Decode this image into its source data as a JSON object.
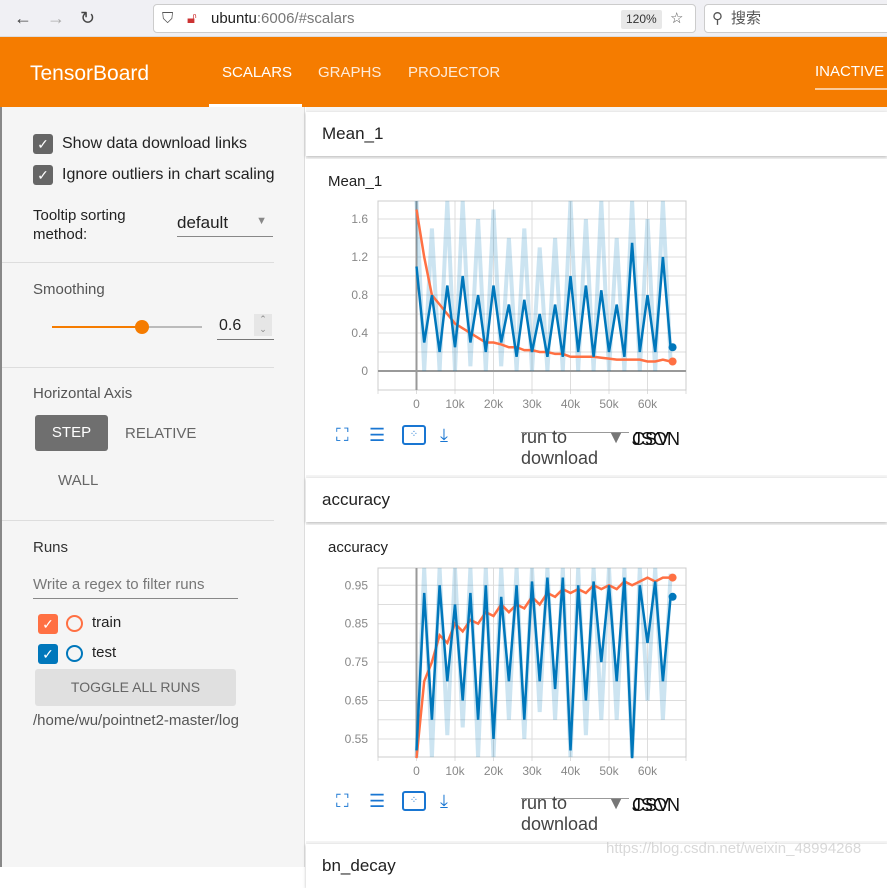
{
  "browser": {
    "back": "←",
    "forward": "→",
    "reload": "↻",
    "url_host": "ubuntu",
    "url_rest": ":6006/#scalars",
    "zoom": "120%",
    "search_placeholder": "搜索"
  },
  "header": {
    "title": "TensorBoard",
    "tabs": [
      {
        "label": "SCALARS",
        "active": true
      },
      {
        "label": "GRAPHS"
      },
      {
        "label": "PROJECTOR"
      }
    ],
    "status": "INACTIVE",
    "color": "#f57c00"
  },
  "sidebar": {
    "show_download_links": {
      "label": "Show data download links",
      "checked": true
    },
    "ignore_outliers": {
      "label": "Ignore outliers in chart scaling",
      "checked": true
    },
    "tooltip_sorting": {
      "label": "Tooltip sorting method:",
      "value": "default"
    },
    "smoothing": {
      "label": "Smoothing",
      "value": "0.6",
      "fraction": 0.6
    },
    "horizontal_axis": {
      "label": "Horizontal Axis",
      "options": [
        "STEP",
        "RELATIVE",
        "WALL"
      ],
      "selected": "STEP"
    },
    "runs": {
      "label": "Runs",
      "filter_placeholder": "Write a regex to filter runs",
      "items": [
        {
          "name": "train",
          "checked": true,
          "color": "#ff7043"
        },
        {
          "name": "test",
          "checked": true,
          "color": "#0077bb"
        }
      ],
      "toggle_all": "TOGGLE ALL RUNS",
      "logdir": "/home/wu/pointnet2-master/log"
    }
  },
  "sections": [
    {
      "title": "Mean_1"
    },
    {
      "title": "accuracy"
    },
    {
      "title": "bn_decay"
    }
  ],
  "card_tools": {
    "run_to_download": "run to download",
    "csv": "CSV",
    "json": "JSON"
  },
  "watermark": "https://blog.csdn.net/weixin_48994268",
  "chart_data": [
    {
      "type": "line",
      "title": "Mean_1",
      "xlim": [
        -10000,
        70000
      ],
      "ylim": [
        -0.2,
        1.79
      ],
      "xticks": [
        "0",
        "10k",
        "20k",
        "30k",
        "40k",
        "50k",
        "60k"
      ],
      "yticks": [
        "0",
        "0.4",
        "0.8",
        "1.2",
        "1.6"
      ],
      "grid": true,
      "x": [
        0,
        2000,
        4000,
        6000,
        8000,
        10000,
        12000,
        14000,
        16000,
        18000,
        20000,
        22000,
        24000,
        26000,
        28000,
        30000,
        32000,
        34000,
        36000,
        38000,
        40000,
        42000,
        44000,
        46000,
        48000,
        50000,
        52000,
        54000,
        56000,
        58000,
        60000,
        62000,
        64000,
        66000
      ],
      "series": [
        {
          "name": "train",
          "color": "#ff7043",
          "values": [
            1.7,
            1.2,
            0.8,
            0.7,
            0.6,
            0.5,
            0.45,
            0.4,
            0.35,
            0.3,
            0.3,
            0.28,
            0.25,
            0.25,
            0.22,
            0.22,
            0.2,
            0.2,
            0.18,
            0.18,
            0.15,
            0.15,
            0.15,
            0.15,
            0.14,
            0.13,
            0.12,
            0.12,
            0.12,
            0.12,
            0.1,
            0.1,
            0.12,
            0.1
          ]
        },
        {
          "name": "test",
          "color": "#0077bb",
          "values": [
            1.1,
            0.3,
            0.8,
            0.2,
            0.9,
            0.25,
            1.0,
            0.3,
            0.8,
            0.2,
            0.9,
            0.3,
            0.7,
            0.15,
            0.75,
            0.2,
            0.6,
            0.15,
            0.7,
            0.15,
            1.0,
            0.2,
            0.9,
            0.15,
            0.85,
            0.2,
            0.7,
            0.15,
            1.35,
            0.2,
            0.8,
            0.2,
            1.2,
            0.25
          ],
          "raw": [
            1.79,
            0.0,
            1.5,
            0.0,
            1.79,
            0.0,
            1.79,
            0.05,
            1.6,
            0.0,
            1.7,
            0.05,
            1.4,
            0.0,
            1.5,
            0.0,
            1.3,
            0.0,
            1.4,
            0.0,
            1.79,
            0.0,
            1.6,
            0.0,
            1.79,
            0.0,
            1.4,
            0.0,
            1.79,
            0.0,
            1.6,
            0.0,
            1.79,
            0.1
          ]
        }
      ]
    },
    {
      "type": "line",
      "title": "accuracy",
      "xlim": [
        -10000,
        70000
      ],
      "ylim": [
        0.503,
        0.995
      ],
      "xticks": [
        "0",
        "10k",
        "20k",
        "30k",
        "40k",
        "50k",
        "60k"
      ],
      "yticks": [
        "0.55",
        "0.65",
        "0.75",
        "0.85",
        "0.95"
      ],
      "grid": true,
      "x": [
        0,
        2000,
        4000,
        6000,
        8000,
        10000,
        12000,
        14000,
        16000,
        18000,
        20000,
        22000,
        24000,
        26000,
        28000,
        30000,
        32000,
        34000,
        36000,
        38000,
        40000,
        42000,
        44000,
        46000,
        48000,
        50000,
        52000,
        54000,
        56000,
        58000,
        60000,
        62000,
        64000,
        66000
      ],
      "series": [
        {
          "name": "train",
          "color": "#ff7043",
          "values": [
            0.5,
            0.7,
            0.75,
            0.82,
            0.8,
            0.85,
            0.83,
            0.86,
            0.85,
            0.88,
            0.87,
            0.9,
            0.88,
            0.9,
            0.89,
            0.92,
            0.9,
            0.93,
            0.92,
            0.94,
            0.93,
            0.94,
            0.93,
            0.95,
            0.94,
            0.95,
            0.94,
            0.96,
            0.95,
            0.96,
            0.97,
            0.96,
            0.97,
            0.97
          ]
        },
        {
          "name": "test",
          "color": "#0077bb",
          "values": [
            0.52,
            0.93,
            0.6,
            0.95,
            0.7,
            0.9,
            0.65,
            0.93,
            0.6,
            0.95,
            0.55,
            0.92,
            0.7,
            0.95,
            0.6,
            0.96,
            0.7,
            0.97,
            0.68,
            0.97,
            0.52,
            0.95,
            0.65,
            0.96,
            0.75,
            0.95,
            0.7,
            0.97,
            0.5,
            0.95,
            0.8,
            0.96,
            0.7,
            0.92
          ],
          "raw": [
            0.503,
            0.995,
            0.503,
            0.995,
            0.56,
            0.995,
            0.58,
            0.995,
            0.503,
            0.995,
            0.503,
            0.995,
            0.6,
            0.995,
            0.55,
            0.995,
            0.62,
            0.995,
            0.6,
            0.995,
            0.503,
            0.995,
            0.56,
            0.995,
            0.6,
            0.995,
            0.6,
            0.995,
            0.503,
            0.995,
            0.65,
            0.995,
            0.6,
            0.98
          ]
        }
      ]
    }
  ]
}
